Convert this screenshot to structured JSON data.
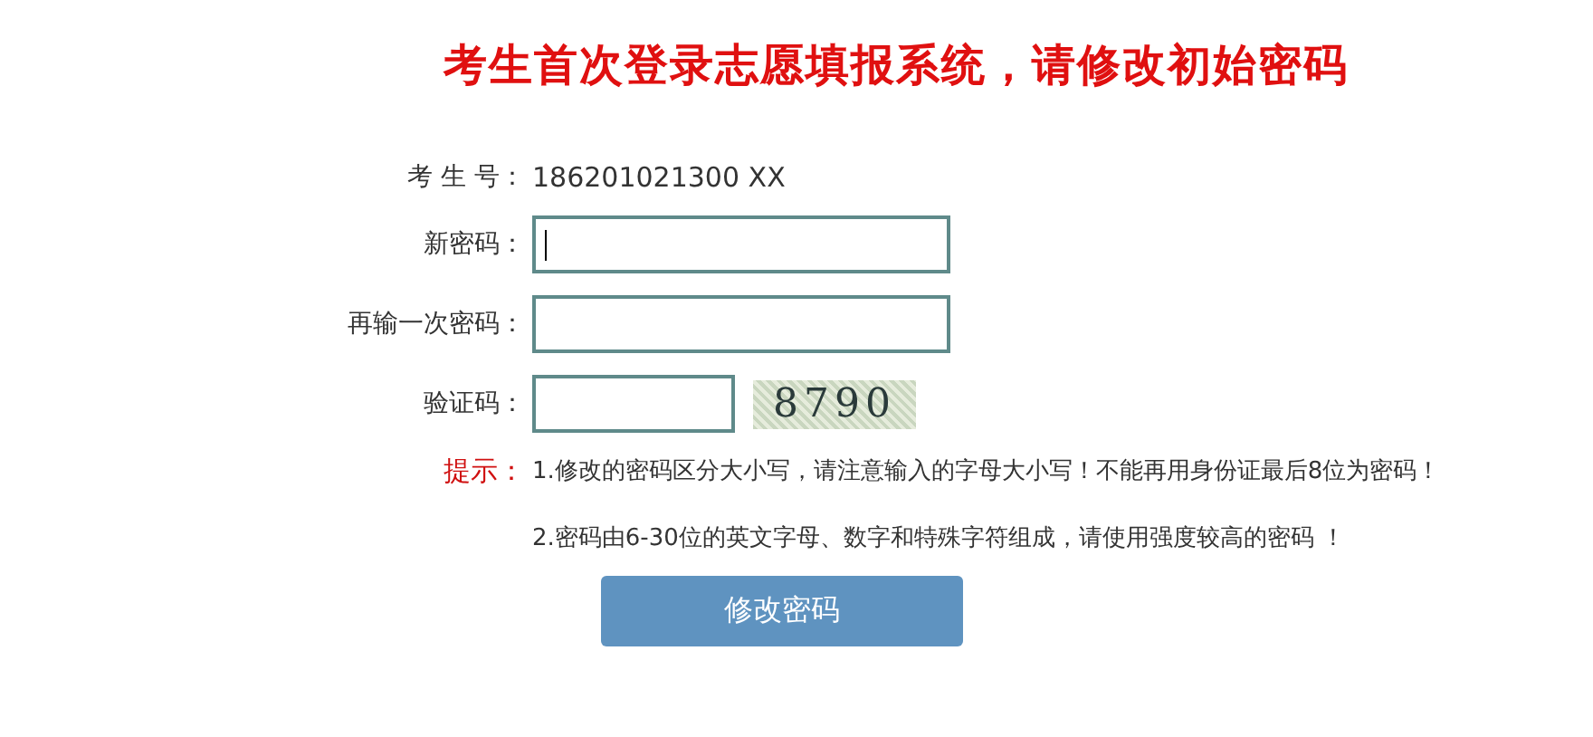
{
  "title": "考生首次登录志愿填报系统，请修改初始密码",
  "exam_number": {
    "label": "考 生 号：",
    "value": "186201021300 XX"
  },
  "fields": [
    {
      "label": "新密码：",
      "focused": true
    },
    {
      "label": "再输一次密码：",
      "focused": false
    }
  ],
  "captcha": {
    "label": "验证码：",
    "code": "8790"
  },
  "hint": {
    "label": "提示：",
    "lines": [
      "1.修改的密码区分大小写，请注意输入的字母大小写！不能再用身份证最后8位为密码！",
      "2.密码由6-30位的英文字母、数字和特殊字符组成，请使用强度较高的密码 ！"
    ]
  },
  "submit_button": "修改密码"
}
